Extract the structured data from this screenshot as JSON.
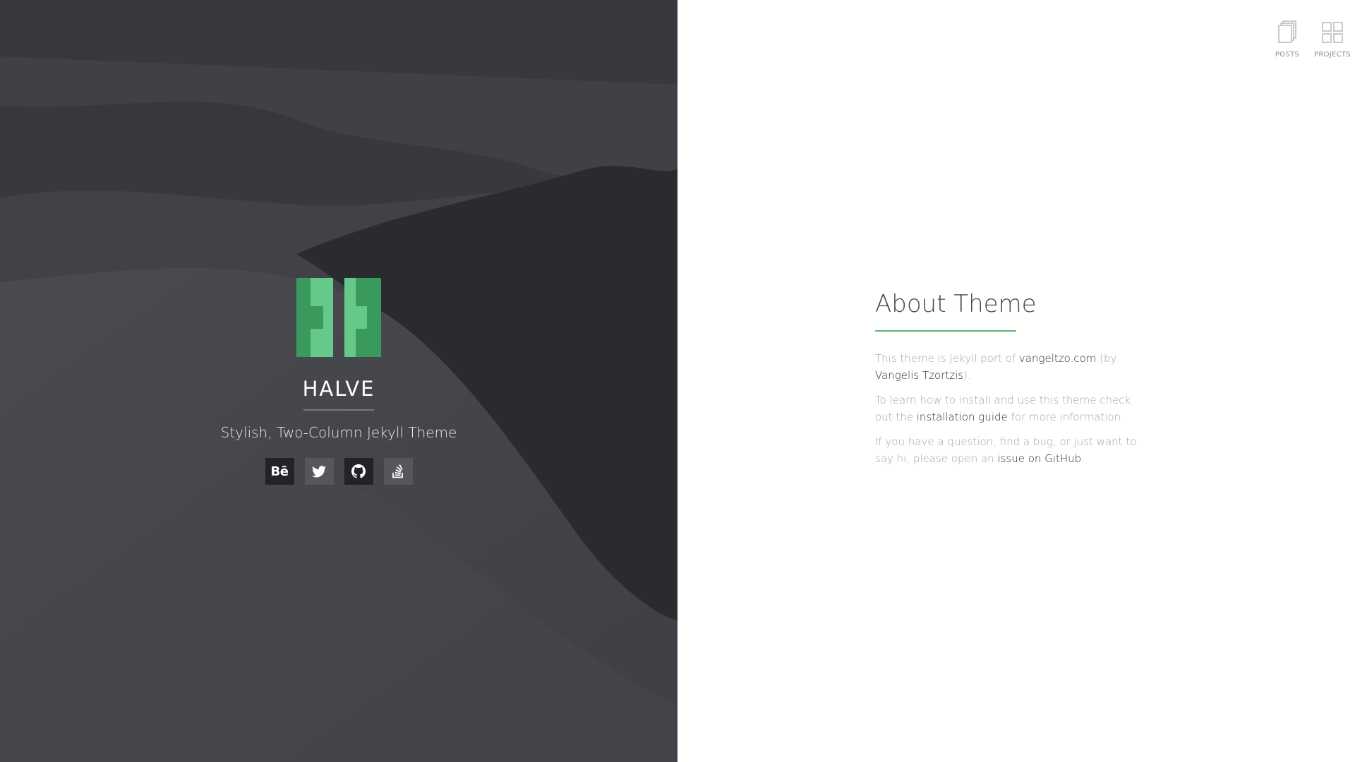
{
  "hero": {
    "title": "HALVE",
    "tagline": "Stylish, Two-Column Jekyll Theme",
    "accent_color": "#5ab96e",
    "social": [
      {
        "name": "behance",
        "label": "Bē",
        "icon": "behance-icon"
      },
      {
        "name": "twitter",
        "icon": "twitter-icon"
      },
      {
        "name": "github",
        "icon": "github-icon"
      },
      {
        "name": "stackoverflow",
        "icon": "stackoverflow-icon"
      }
    ]
  },
  "nav": {
    "posts_label": "POSTS",
    "projects_label": "PROJECTS"
  },
  "about": {
    "title": "About Theme",
    "p1": {
      "text_a": "This theme is Jekyll port of ",
      "link_a": "vangeltzo.com",
      "text_b": " (by ",
      "link_b": "Vangelis Tzortzis",
      "text_c": ")."
    },
    "p2": {
      "text_a": "To learn how to install and use this theme check out the ",
      "link_a": "installation guide",
      "text_b": " for more information."
    },
    "p3": {
      "text_a": "If you have a question, find a bug, or just want to say hi, please open an ",
      "link_a": "issue on GitHub",
      "text_b": "."
    }
  }
}
